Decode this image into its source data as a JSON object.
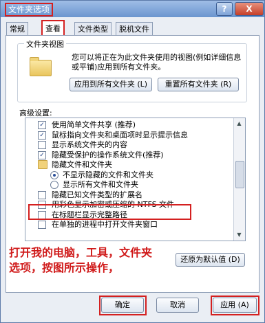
{
  "window": {
    "title": "文件夹选项",
    "help_label": "?",
    "close_label": "X"
  },
  "tabs": [
    {
      "label": "常规"
    },
    {
      "label": "查看"
    },
    {
      "label": "文件类型"
    },
    {
      "label": "脱机文件"
    }
  ],
  "folder_views": {
    "group_title": "文件夹视图",
    "description": "您可以将正在为此文件夹使用的视图(例如详细信息或平铺)应用到所有文件夹。",
    "apply_all_label": "应用到所有文件夹 (L)",
    "reset_all_label": "重置所有文件夹 (R)"
  },
  "advanced": {
    "label": "高级设置:",
    "items": [
      {
        "type": "checkbox",
        "checked": true,
        "label": "使用简单文件共享 (推荐)"
      },
      {
        "type": "checkbox",
        "checked": true,
        "label": "鼠标指向文件夹和桌面项时显示提示信息"
      },
      {
        "type": "checkbox",
        "checked": false,
        "label": "显示系统文件夹的内容"
      },
      {
        "type": "checkbox",
        "checked": true,
        "label": "隐藏受保护的操作系统文件(推荐)"
      },
      {
        "type": "folder",
        "label": "隐藏文件和文件夹"
      },
      {
        "type": "radio",
        "checked": true,
        "label": "不显示隐藏的文件和文件夹"
      },
      {
        "type": "radio",
        "checked": false,
        "label": "显示所有文件和文件夹"
      },
      {
        "type": "checkbox",
        "checked": false,
        "label": "隐藏已知文件类型的扩展名"
      },
      {
        "type": "checkbox",
        "checked": false,
        "label": "用彩色显示加密或压缩的 NTFS 文件"
      },
      {
        "type": "checkbox",
        "checked": false,
        "label": "在标题栏显示完整路径"
      },
      {
        "type": "checkbox",
        "checked": false,
        "label": "在单独的进程中打开文件夹窗口"
      }
    ]
  },
  "annotation": "打开我的电脑，工具，文件夹选项，按图所示操作，",
  "restore_defaults_label": "还原为默认值 (D)",
  "buttons": {
    "ok": "确定",
    "cancel": "取消",
    "apply": "应用 (A)"
  },
  "colors": {
    "highlight_red": "#d42020",
    "title_gradient": "#6b95cf"
  }
}
